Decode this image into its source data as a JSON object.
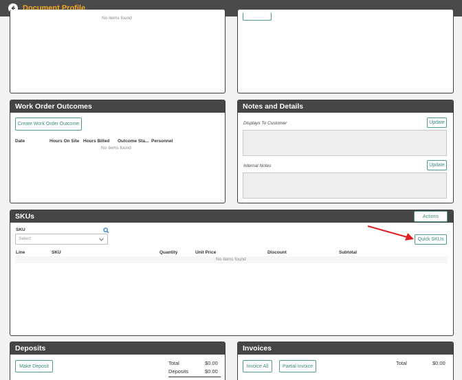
{
  "app": {
    "title": "Document Profile"
  },
  "top_left_panel": {
    "empty_text": "No items found"
  },
  "work_order_outcomes": {
    "title": "Work Order Outcomes",
    "create_button": "Create Work Order Outcome",
    "columns": [
      "Date",
      "Hours On Site",
      "Hours Billed",
      "Outcome Sta...",
      "Personnel"
    ],
    "empty_text": "No items found"
  },
  "notes": {
    "title": "Notes and Details",
    "displays_label": "Displays To Customer",
    "internal_label": "Internal Notes",
    "update_label": "Update"
  },
  "skus": {
    "title": "SKUs",
    "actions_label": "Actions",
    "field_label": "SKU",
    "select_placeholder": "Select",
    "quick_skus_label": "Quick SKUs",
    "columns": [
      "Line",
      "SKU",
      "Quantity",
      "Unit Price",
      "Discount",
      "Subtotal"
    ],
    "empty_text": "No items found"
  },
  "deposits": {
    "title": "Deposits",
    "make_deposit": "Make Deposit",
    "total_label": "Total",
    "total_value": "$0.00",
    "deposits_label": "Deposits",
    "deposits_value": "$0.00"
  },
  "invoices": {
    "title": "Invoices",
    "invoice_all": "Invoice All",
    "partial_invoice": "Partial Invoice",
    "total_label": "Total",
    "total_value": "$0.00"
  },
  "colors": {
    "accent": "#4a9a8f",
    "title": "#f5a623",
    "header": "#454545",
    "arrow": "#e02020"
  },
  "icons": [
    "back-arrow-icon",
    "search-icon",
    "chevron-down-icon"
  ]
}
